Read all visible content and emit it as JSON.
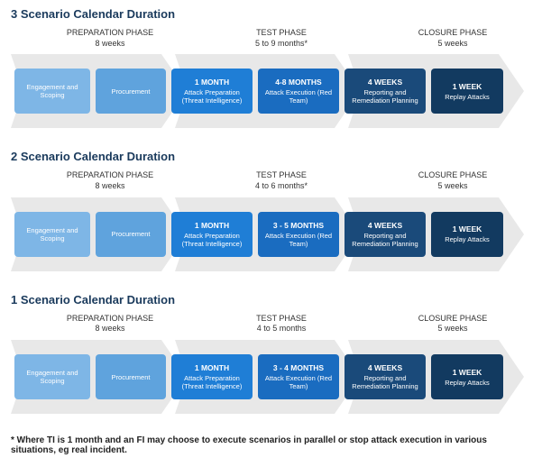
{
  "footnote": "* Where TI is 1 month and an FI may choose to execute scenarios in parallel or stop attack execution in various situations, eg real incident.",
  "phases": {
    "prep": {
      "name": "PREPARATION PHASE",
      "duration": "8 weeks"
    },
    "closure": {
      "name": "CLOSURE PHASE",
      "duration": "5 weeks"
    }
  },
  "boxes_common": {
    "engagement": "Engagement and Scoping",
    "procurement": "Procurement",
    "month1_dur": "1 MONTH",
    "month1_lbl": "Attack Preparation (Threat Intelligence)",
    "exec_lbl": "Attack Execution (Red Team)",
    "report_dur": "4 WEEKS",
    "report_lbl": "Reporting and Remediation Planning",
    "replay_dur": "1 WEEK",
    "replay_lbl": "Replay Attacks"
  },
  "scenarios": [
    {
      "title": "3 Scenario Calendar Duration",
      "test_name": "TEST PHASE",
      "test_duration": "5 to 9 months*",
      "exec_dur": "4-8 MONTHS"
    },
    {
      "title": "2 Scenario Calendar Duration",
      "test_name": "TEST PHASE",
      "test_duration": "4 to 6 months*",
      "exec_dur": "3 - 5 MONTHS"
    },
    {
      "title": "1 Scenario Calendar Duration",
      "test_name": "TEST PHASE",
      "test_duration": "4 to 5 months",
      "exec_dur": "3 - 4 MONTHS"
    }
  ],
  "chart_data": [
    {
      "type": "table",
      "title": "3 Scenario Calendar Duration",
      "phases": [
        {
          "phase": "PREPARATION PHASE",
          "duration": "8 weeks",
          "steps": [
            "Engagement and Scoping",
            "Procurement"
          ]
        },
        {
          "phase": "TEST PHASE",
          "duration": "5 to 9 months*",
          "steps": [
            {
              "label": "Attack Preparation (Threat Intelligence)",
              "duration": "1 MONTH"
            },
            {
              "label": "Attack Execution (Red Team)",
              "duration": "4-8 MONTHS"
            }
          ]
        },
        {
          "phase": "CLOSURE PHASE",
          "duration": "5 weeks",
          "steps": [
            {
              "label": "Reporting and Remediation Planning",
              "duration": "4 WEEKS"
            },
            {
              "label": "Replay Attacks",
              "duration": "1 WEEK"
            }
          ]
        }
      ]
    },
    {
      "type": "table",
      "title": "2 Scenario Calendar Duration",
      "phases": [
        {
          "phase": "PREPARATION PHASE",
          "duration": "8 weeks",
          "steps": [
            "Engagement and Scoping",
            "Procurement"
          ]
        },
        {
          "phase": "TEST PHASE",
          "duration": "4 to 6 months*",
          "steps": [
            {
              "label": "Attack Preparation (Threat Intelligence)",
              "duration": "1 MONTH"
            },
            {
              "label": "Attack Execution (Red Team)",
              "duration": "3 - 5 MONTHS"
            }
          ]
        },
        {
          "phase": "CLOSURE PHASE",
          "duration": "5 weeks",
          "steps": [
            {
              "label": "Reporting and Remediation Planning",
              "duration": "4 WEEKS"
            },
            {
              "label": "Replay Attacks",
              "duration": "1 WEEK"
            }
          ]
        }
      ]
    },
    {
      "type": "table",
      "title": "1 Scenario Calendar Duration",
      "phases": [
        {
          "phase": "PREPARATION PHASE",
          "duration": "8 weeks",
          "steps": [
            "Engagement and Scoping",
            "Procurement"
          ]
        },
        {
          "phase": "TEST PHASE",
          "duration": "4 to 5 months",
          "steps": [
            {
              "label": "Attack Preparation (Threat Intelligence)",
              "duration": "1 MONTH"
            },
            {
              "label": "Attack Execution (Red Team)",
              "duration": "3 - 4 MONTHS"
            }
          ]
        },
        {
          "phase": "CLOSURE PHASE",
          "duration": "5 weeks",
          "steps": [
            {
              "label": "Reporting and Remediation Planning",
              "duration": "4 WEEKS"
            },
            {
              "label": "Replay Attacks",
              "duration": "1 WEEK"
            }
          ]
        }
      ]
    }
  ]
}
